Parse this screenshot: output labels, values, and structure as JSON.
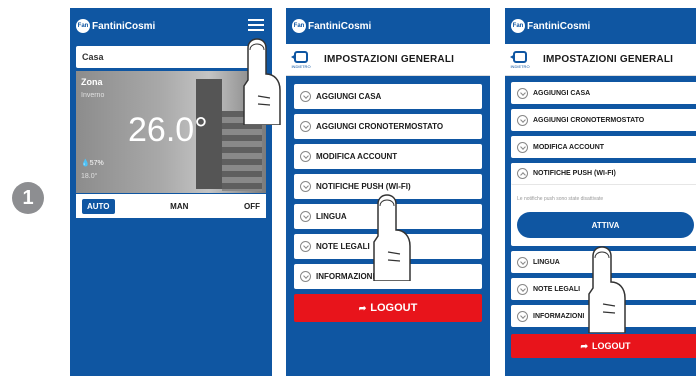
{
  "step_number": "1",
  "brand": {
    "name": "FantiniCosmi",
    "mark": "Fan"
  },
  "screen1": {
    "house": "Casa",
    "zone": {
      "title": "Zona",
      "mode": "Inverno",
      "temperature": "26.0°",
      "humidity": "57%",
      "setpoint": "18.0°"
    },
    "modes": {
      "auto": "AUTO",
      "man": "MAN",
      "off": "OFF"
    }
  },
  "settings": {
    "back_label": "INDIETRO",
    "title": "IMPOSTAZIONI GENERALI",
    "items": [
      "AGGIUNGI CASA",
      "AGGIUNGI CRONOTERMOSTATO",
      "MODIFICA ACCOUNT",
      "NOTIFICHE PUSH (WI-FI)",
      "LINGUA",
      "NOTE LEGALI",
      "INFORMAZIONI"
    ],
    "logout": "LOGOUT",
    "push_notice": "Le notifiche push sono state disattivate",
    "activate": "ATTIVA"
  },
  "colors": {
    "brand_blue": "#0f56a2",
    "logout_red": "#e8141b",
    "badge_gray": "#8d8e91"
  }
}
